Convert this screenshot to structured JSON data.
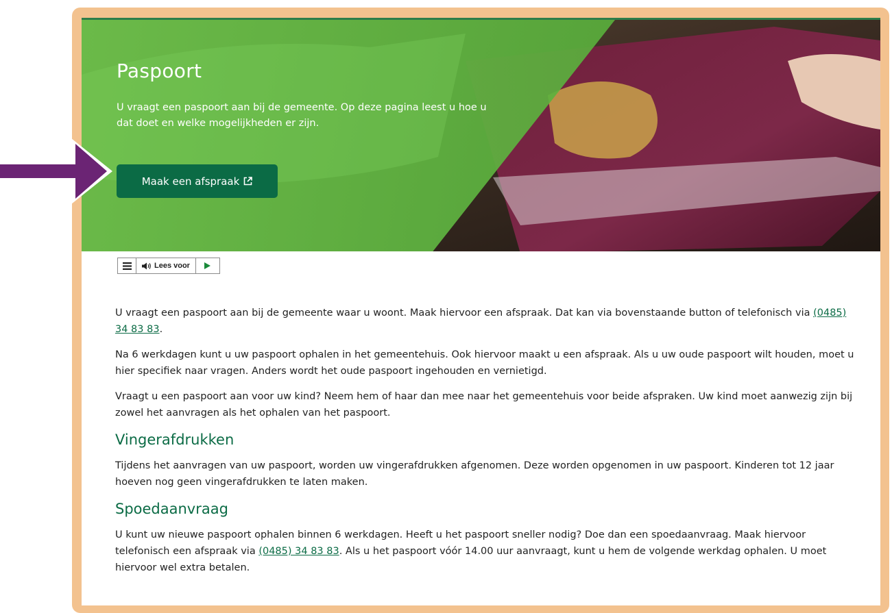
{
  "hero": {
    "title": "Paspoort",
    "intro": "U vraagt een paspoort aan bij de gemeente. Op deze pagina leest u hoe u dat doet en welke mogelijkheden er zijn.",
    "cta_label": "Maak een afspraak",
    "cta_icon": "external-link-icon"
  },
  "readspeaker": {
    "menu_icon": "menu-icon",
    "speaker_icon": "speaker-icon",
    "label": "Lees voor",
    "play_icon": "play-icon"
  },
  "content": {
    "p1_text": "U vraagt een paspoort aan bij de gemeente waar u woont. Maak hiervoor een afspraak. Dat kan via bovenstaande button of telefonisch via ",
    "p1_link": "(0485) 34 83 83",
    "p1_end": ".",
    "p2": "Na 6 werkdagen kunt u uw paspoort ophalen in het gemeentehuis. Ook hiervoor maakt u een afspraak. Als u uw oude paspoort wilt houden, moet u hier specifiek naar vragen. Anders wordt het oude paspoort ingehouden en vernietigd.",
    "p3": "Vraagt u een paspoort aan voor uw kind? Neem hem of haar dan mee naar het gemeentehuis voor beide afspraken. Uw kind moet aanwezig zijn bij zowel het aanvragen als het ophalen van het paspoort.",
    "h2_1": "Vingerafdrukken",
    "p4": "Tijdens het aanvragen van uw paspoort, worden uw vingerafdrukken afgenomen. Deze worden opgenomen in uw paspoort. Kinderen tot 12 jaar hoeven nog geen vingerafdrukken te laten maken.",
    "h2_2": "Spoedaanvraag",
    "p5_text": "U kunt uw nieuwe paspoort ophalen binnen 6 werkdagen. Heeft u het paspoort sneller nodig? Doe dan een spoedaanvraag. Maak hiervoor telefonisch een afspraak via ",
    "p5_link": "(0485) 34 83 83",
    "p5_end": ". Als u het paspoort vóór 14.00 uur aanvraagt, kunt u hem de volgende werkdag ophalen. U moet hiervoor wel extra betalen."
  },
  "colors": {
    "brand_green": "#0b6b45",
    "frame": "#f3c28f",
    "arrow": "#6b2474"
  }
}
